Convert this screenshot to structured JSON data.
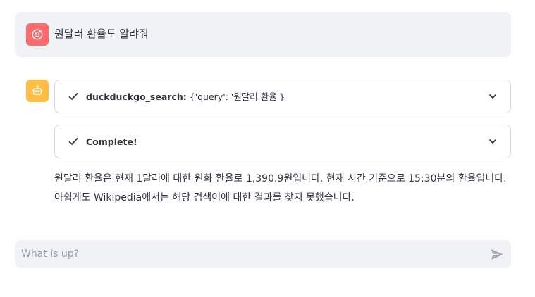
{
  "user_message": {
    "text": "원달러 환율도 알랴줘",
    "avatar_icon": "user-face-icon",
    "avatar_color": "#ff6b6b"
  },
  "assistant_message": {
    "avatar_icon": "robot-icon",
    "avatar_color": "#ffbd45",
    "steps": [
      {
        "tool": "duckduckgo_search:",
        "args": "{'query': '원달러 환율'}",
        "status_icon": "check-icon",
        "expander_icon": "chevron-down-icon"
      },
      {
        "tool": "Complete!",
        "args": "",
        "status_icon": "check-icon",
        "expander_icon": "chevron-down-icon"
      }
    ],
    "answer": "원달러 환율은 현재 1달러에 대한 원화 환율로 1,390.9원입니다. 현재 시간 기준으로 15:30분의 환율입니다. 아쉽게도 Wikipedia에서는 해당 검색어에 대한 결과를 찾지 못했습니다."
  },
  "chat_input": {
    "placeholder": "What is up?",
    "value": "",
    "send_icon": "send-icon"
  }
}
